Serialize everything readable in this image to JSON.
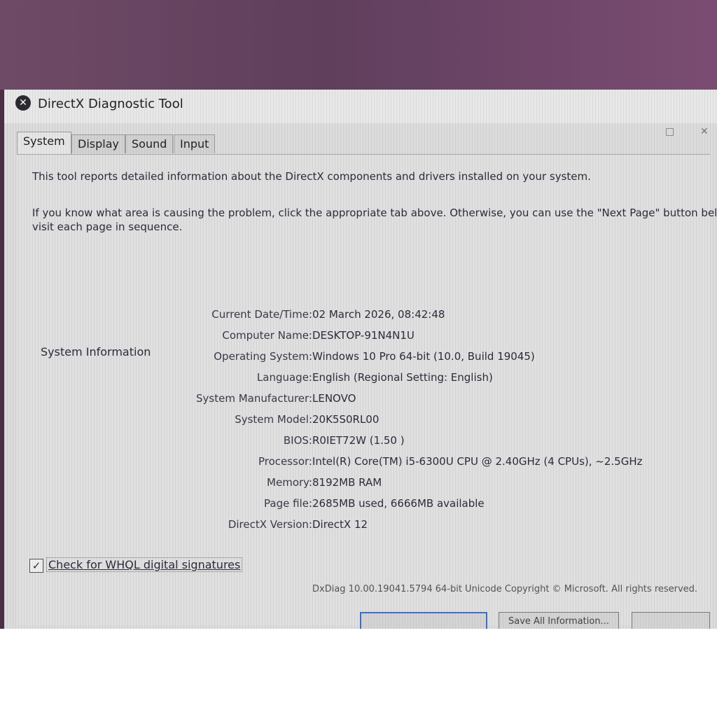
{
  "window": {
    "title": "DirectX Diagnostic Tool"
  },
  "tabs": [
    "System",
    "Display",
    "Sound",
    "Input"
  ],
  "intro": {
    "line1": "This tool reports detailed information about the DirectX components and drivers installed on your system.",
    "line2": "If you know what area is causing the problem, click the appropriate tab above.  Otherwise, you can use the \"Next Page\" button below to",
    "line3": "visit each page in sequence."
  },
  "system_info": {
    "heading": "System Information",
    "rows": [
      {
        "label": "Current Date/Time:",
        "value": "02 March 2026, 08:42:48"
      },
      {
        "label": "Computer Name:",
        "value": "DESKTOP-91N4N1U"
      },
      {
        "label": "Operating System:",
        "value": "Windows 10 Pro 64-bit (10.0, Build 19045)"
      },
      {
        "label": "Language:",
        "value": "English (Regional Setting: English)"
      },
      {
        "label": "System Manufacturer:",
        "value": "LENOVO"
      },
      {
        "label": "System Model:",
        "value": "20K5S0RL00"
      },
      {
        "label": "BIOS:",
        "value": "R0IET72W (1.50 )"
      },
      {
        "label": "Processor:",
        "value": "Intel(R) Core(TM) i5-6300U CPU @ 2.40GHz (4 CPUs), ~2.5GHz"
      },
      {
        "label": "Memory:",
        "value": "8192MB RAM"
      },
      {
        "label": "Page file:",
        "value": "2685MB used, 6666MB available"
      },
      {
        "label": "DirectX Version:",
        "value": "DirectX 12"
      }
    ]
  },
  "whql": {
    "label": "Check for WHQL digital signatures",
    "checked": true,
    "check_glyph": "✓"
  },
  "footer": {
    "text": "DxDiag 10.00.19041.5794 64-bit Unicode  Copyright © Microsoft. All rights reserved."
  },
  "buttons": {
    "save_all": "Save All Information..."
  }
}
